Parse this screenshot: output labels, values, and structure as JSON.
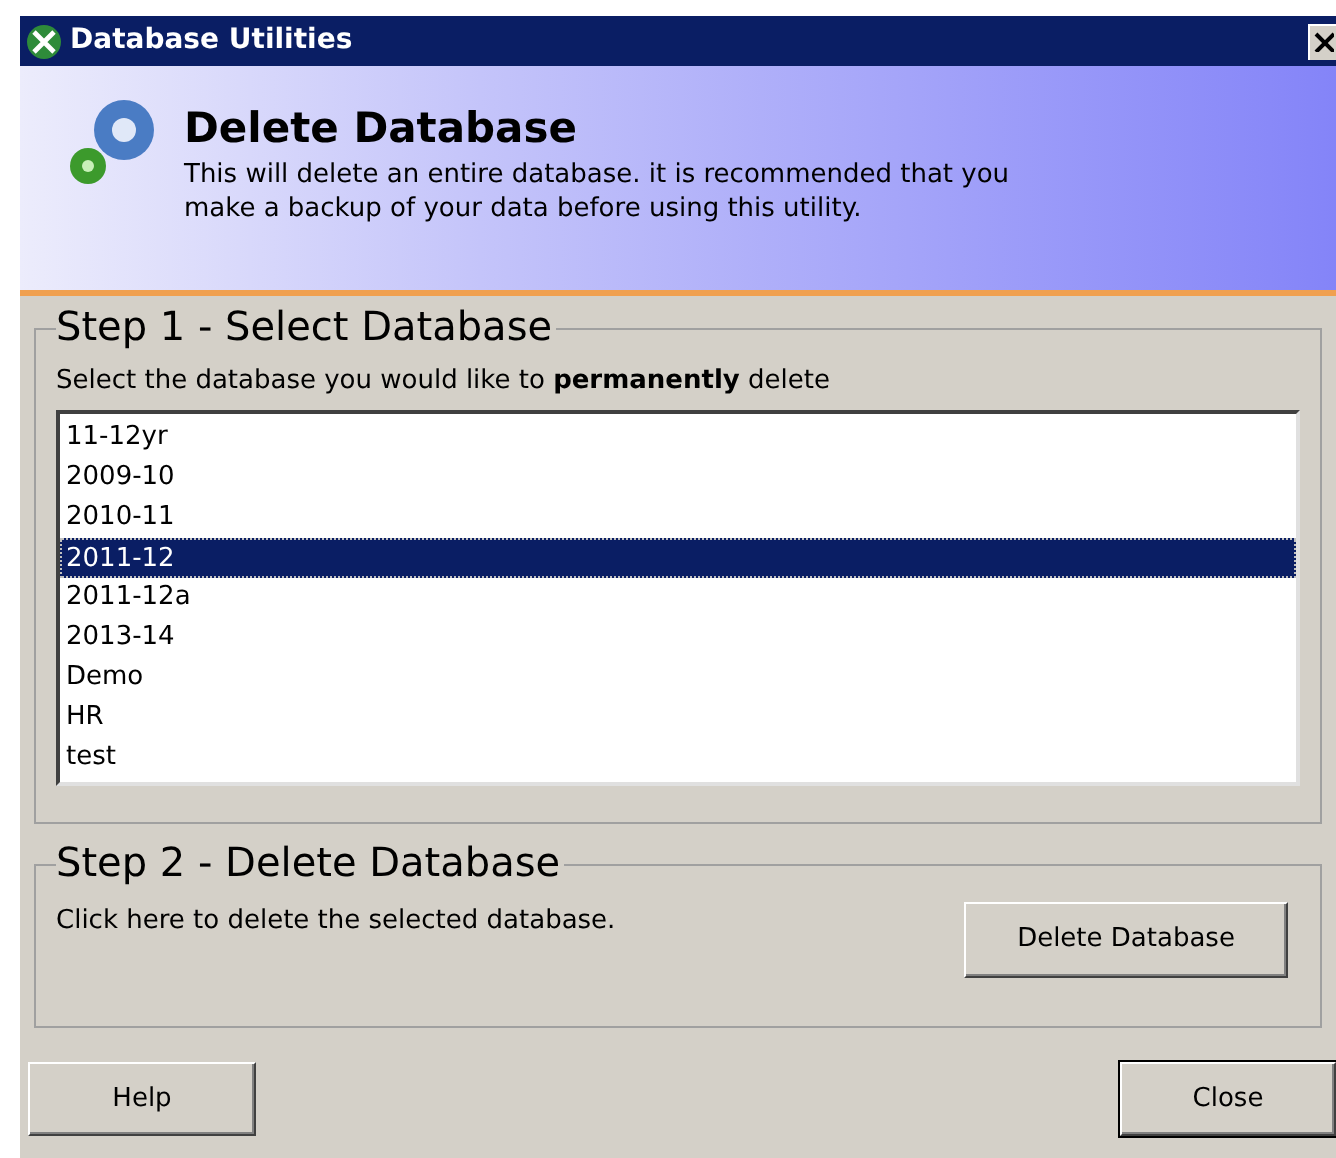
{
  "window": {
    "title": "Database Utilities"
  },
  "header": {
    "title": "Delete Database",
    "description": "This will delete an entire database. it is recommended that you make a backup of your data before using this utility."
  },
  "step1": {
    "heading": "Step 1 - Select Database",
    "instruction": "Select the database you would like to **permanently** delete",
    "databases": [
      {
        "label": "11-12yr",
        "selected": false
      },
      {
        "label": "2009-10",
        "selected": false
      },
      {
        "label": "2010-11",
        "selected": false
      },
      {
        "label": "2011-12",
        "selected": true
      },
      {
        "label": "2011-12a",
        "selected": false
      },
      {
        "label": "2013-14",
        "selected": false
      },
      {
        "label": "Demo",
        "selected": false
      },
      {
        "label": "HR",
        "selected": false
      },
      {
        "label": "test",
        "selected": false
      }
    ]
  },
  "step2": {
    "heading": "Step 2 - Delete Database",
    "instruction": "Click here to delete the selected database.",
    "button": "Delete Database"
  },
  "buttons": {
    "help": "Help",
    "close": "Close"
  }
}
